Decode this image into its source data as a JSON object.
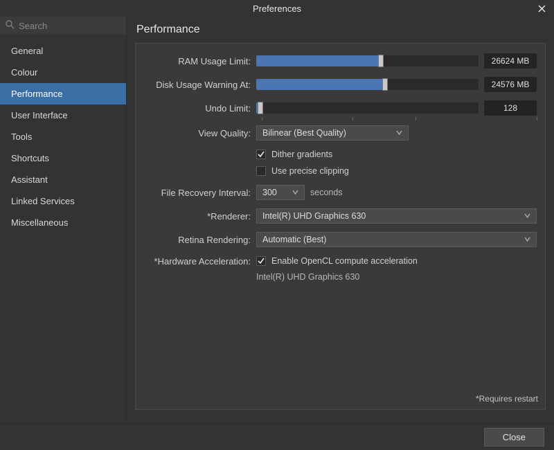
{
  "window": {
    "title": "Preferences"
  },
  "search": {
    "placeholder": "Search"
  },
  "sidebar": {
    "items": [
      {
        "label": "General"
      },
      {
        "label": "Colour"
      },
      {
        "label": "Performance",
        "selected": true
      },
      {
        "label": "User Interface"
      },
      {
        "label": "Tools"
      },
      {
        "label": "Shortcuts"
      },
      {
        "label": "Assistant"
      },
      {
        "label": "Linked Services"
      },
      {
        "label": "Miscellaneous"
      }
    ]
  },
  "page": {
    "title": "Performance"
  },
  "settings": {
    "ram_limit": {
      "label": "RAM Usage Limit:",
      "value": "26624 MB",
      "pct": 56
    },
    "disk_warning": {
      "label": "Disk Usage Warning At:",
      "value": "24576 MB",
      "pct": 58
    },
    "undo_limit": {
      "label": "Undo Limit:",
      "value": "128",
      "pct": 2
    },
    "view_quality": {
      "label": "View Quality:",
      "value": "Bilinear (Best Quality)"
    },
    "dither_gradients": {
      "label": "Dither gradients",
      "checked": true
    },
    "precise_clipping": {
      "label": "Use precise clipping",
      "checked": false
    },
    "file_recovery": {
      "label": "File Recovery Interval:",
      "value": "300",
      "unit": "seconds"
    },
    "renderer": {
      "label": "*Renderer:",
      "value": "Intel(R) UHD Graphics 630"
    },
    "retina": {
      "label": "Retina Rendering:",
      "value": "Automatic (Best)"
    },
    "hw_accel": {
      "label": "*Hardware Acceleration:",
      "check_label": "Enable OpenCL compute acceleration",
      "checked": true,
      "device": "Intel(R) UHD Graphics 630"
    }
  },
  "footer": {
    "note": "*Requires restart",
    "close": "Close"
  }
}
